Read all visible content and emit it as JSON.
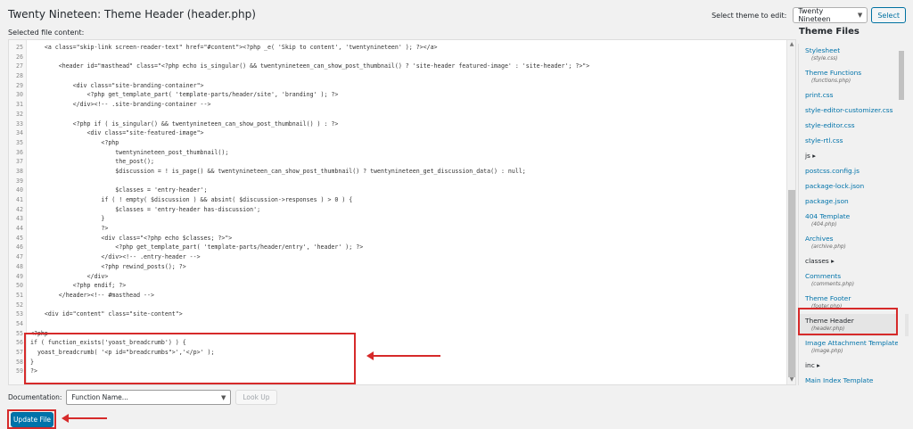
{
  "page": {
    "title": "Twenty Nineteen: Theme Header (header.php)",
    "select_theme_label": "Select theme to edit:",
    "select_theme_value": "Twenty Nineteen",
    "select_button": "Select",
    "file_content_label": "Selected file content:"
  },
  "code_lines": [
    {
      "n": "25",
      "text": "    <a class=\"skip-link screen-reader-text\" href=\"#content\"><?php _e( 'Skip to content', 'twentynineteen' ); ?></a>"
    },
    {
      "n": "26",
      "text": ""
    },
    {
      "n": "27",
      "text": "        <header id=\"masthead\" class=\"<?php echo is_singular() && twentynineteen_can_show_post_thumbnail() ? 'site-header featured-image' : 'site-header'; ?>\">"
    },
    {
      "n": "28",
      "text": ""
    },
    {
      "n": "29",
      "text": "            <div class=\"site-branding-container\">"
    },
    {
      "n": "30",
      "text": "                <?php get_template_part( 'template-parts/header/site', 'branding' ); ?>"
    },
    {
      "n": "31",
      "text": "            </div><!-- .site-branding-container -->"
    },
    {
      "n": "32",
      "text": ""
    },
    {
      "n": "33",
      "text": "            <?php if ( is_singular() && twentynineteen_can_show_post_thumbnail() ) : ?>"
    },
    {
      "n": "34",
      "text": "                <div class=\"site-featured-image\">"
    },
    {
      "n": "35",
      "text": "                    <?php"
    },
    {
      "n": "36",
      "text": "                        twentynineteen_post_thumbnail();"
    },
    {
      "n": "37",
      "text": "                        the_post();"
    },
    {
      "n": "38",
      "text": "                        $discussion = ! is_page() && twentynineteen_can_show_post_thumbnail() ? twentynineteen_get_discussion_data() : null;"
    },
    {
      "n": "39",
      "text": ""
    },
    {
      "n": "40",
      "text": "                        $classes = 'entry-header';"
    },
    {
      "n": "41",
      "text": "                    if ( ! empty( $discussion ) && absint( $discussion->responses ) > 0 ) {"
    },
    {
      "n": "42",
      "text": "                        $classes = 'entry-header has-discussion';"
    },
    {
      "n": "43",
      "text": "                    }"
    },
    {
      "n": "44",
      "text": "                    ?>"
    },
    {
      "n": "45",
      "text": "                    <div class=\"<?php echo $classes; ?>\">"
    },
    {
      "n": "46",
      "text": "                        <?php get_template_part( 'template-parts/header/entry', 'header' ); ?>"
    },
    {
      "n": "47",
      "text": "                    </div><!-- .entry-header -->"
    },
    {
      "n": "48",
      "text": "                    <?php rewind_posts(); ?>"
    },
    {
      "n": "49",
      "text": "                </div>"
    },
    {
      "n": "50",
      "text": "            <?php endif; ?>"
    },
    {
      "n": "51",
      "text": "        </header><!-- #masthead -->"
    },
    {
      "n": "52",
      "text": ""
    },
    {
      "n": "53",
      "text": "    <div id=\"content\" class=\"site-content\">"
    },
    {
      "n": "54",
      "text": ""
    },
    {
      "n": "55",
      "text": "<?php"
    },
    {
      "n": "56",
      "text": "if ( function_exists('yoast_breadcrumb') ) {"
    },
    {
      "n": "57",
      "text": "  yoast_breadcrumb( '<p id=\"breadcrumbs\">','</p>' );"
    },
    {
      "n": "58",
      "text": "}"
    },
    {
      "n": "59",
      "text": "?>"
    }
  ],
  "sidebar": {
    "title": "Theme Files",
    "files": [
      {
        "label": "Stylesheet",
        "sub": "(style.css)",
        "type": "file"
      },
      {
        "label": "Theme Functions",
        "sub": "(functions.php)",
        "type": "file"
      },
      {
        "label": "print.css",
        "sub": "",
        "type": "file"
      },
      {
        "label": "style-editor-customizer.css",
        "sub": "",
        "type": "file"
      },
      {
        "label": "style-editor.css",
        "sub": "",
        "type": "file"
      },
      {
        "label": "style-rtl.css",
        "sub": "",
        "type": "file"
      },
      {
        "label": "js ▸",
        "sub": "",
        "type": "folder"
      },
      {
        "label": "postcss.config.js",
        "sub": "",
        "type": "file"
      },
      {
        "label": "package-lock.json",
        "sub": "",
        "type": "file"
      },
      {
        "label": "package.json",
        "sub": "",
        "type": "file"
      },
      {
        "label": "404 Template",
        "sub": "(404.php)",
        "type": "file"
      },
      {
        "label": "Archives",
        "sub": "(archive.php)",
        "type": "file"
      },
      {
        "label": "classes ▸",
        "sub": "",
        "type": "folder"
      },
      {
        "label": "Comments",
        "sub": "(comments.php)",
        "type": "file"
      },
      {
        "label": "Theme Footer",
        "sub": "(footer.php)",
        "type": "file"
      },
      {
        "label": "Theme Header",
        "sub": "(header.php)",
        "type": "active"
      },
      {
        "label": "Image Attachment Template",
        "sub": "(image.php)",
        "type": "file"
      },
      {
        "label": "inc ▸",
        "sub": "",
        "type": "folder"
      },
      {
        "label": "Main Index Template",
        "sub": "",
        "type": "file"
      }
    ]
  },
  "documentation": {
    "label": "Documentation:",
    "placeholder": "Function Name...",
    "lookup_button": "Look Up"
  },
  "update_button": "Update File",
  "colors": {
    "link": "#0073aa",
    "annotation": "#d62a2a",
    "primary_button": "#0073aa"
  }
}
